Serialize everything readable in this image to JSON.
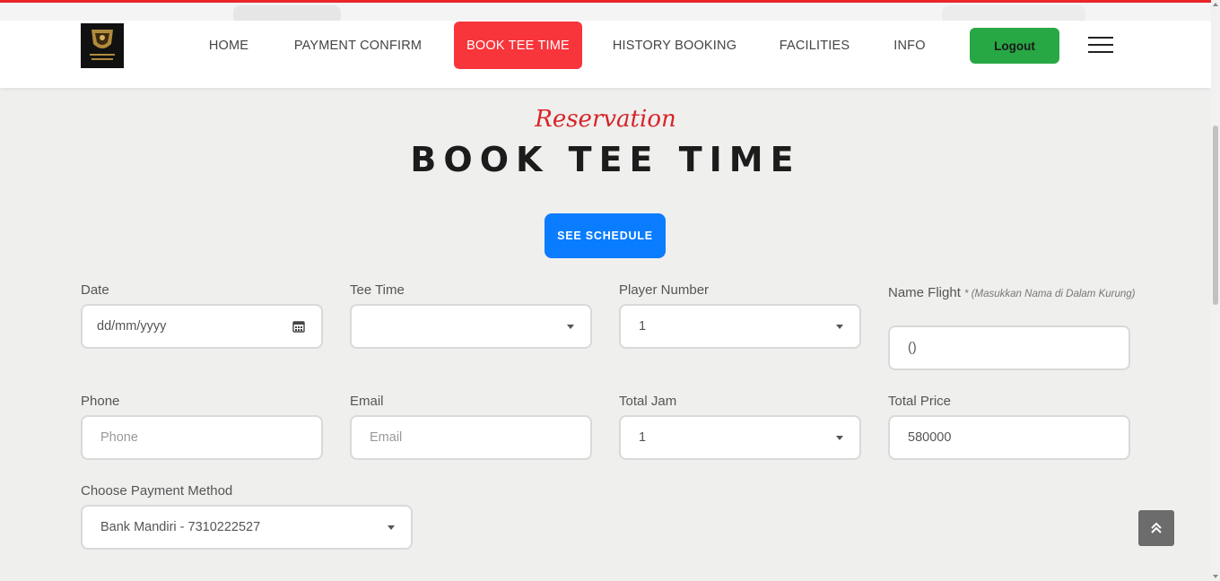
{
  "nav": {
    "items": [
      {
        "label": "HOME"
      },
      {
        "label": "PAYMENT CONFIRM"
      },
      {
        "label": "BOOK TEE TIME"
      },
      {
        "label": "HISTORY BOOKING"
      },
      {
        "label": "FACILITIES"
      },
      {
        "label": "INFO"
      }
    ],
    "logout_label": "Logout"
  },
  "brand": {
    "logo_icon": "sentul-highlands-logo",
    "accent": "#f7353b"
  },
  "header": {
    "subtitle": "Reservation",
    "title": "BOOK TEE TIME"
  },
  "schedule_button": "SEE SCHEDULE",
  "form": {
    "date": {
      "label": "Date",
      "placeholder": "dd/mm/yyyy"
    },
    "tee_time": {
      "label": "Tee Time",
      "value": ""
    },
    "player_number": {
      "label": "Player Number",
      "value": "1"
    },
    "name_flight": {
      "label": "Name Flight",
      "note": "* (Masukkan Nama di Dalam Kurung)",
      "value": "()"
    },
    "phone": {
      "label": "Phone",
      "placeholder": "Phone"
    },
    "email": {
      "label": "Email",
      "placeholder": "Email"
    },
    "total_jam": {
      "label": "Total Jam",
      "value": "1"
    },
    "total_price": {
      "label": "Total Price",
      "value": "580000"
    },
    "payment_method": {
      "label": "Choose Payment Method",
      "value": "Bank Mandiri - 7310222527"
    }
  },
  "colors": {
    "primary_button": "#0a7cff",
    "logout": "#28a745",
    "subtitle": "#d72428"
  }
}
